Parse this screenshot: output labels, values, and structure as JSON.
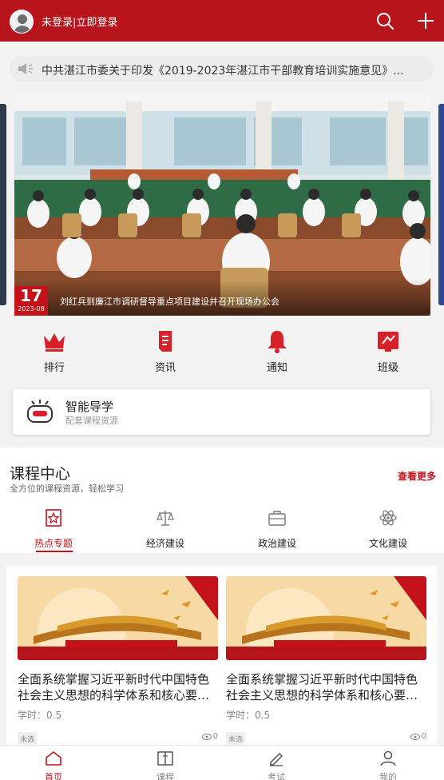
{
  "header": {
    "login_text": "未登录|立即登录",
    "icons": [
      "search-icon",
      "plus-icon"
    ],
    "brand_color": "#b8141c"
  },
  "notice": {
    "text": "中共湛江市委关于印发《2019-2023年湛江市干部教育培训实施意见》..."
  },
  "banner": {
    "day": "17",
    "month": "2023-08",
    "caption": "刘红兵到廉江市调研督导重点项目建设并召开现场办公会"
  },
  "quick_links": [
    {
      "label": "排行",
      "icon": "crown-icon"
    },
    {
      "label": "资讯",
      "icon": "document-icon"
    },
    {
      "label": "通知",
      "icon": "bell-icon"
    },
    {
      "label": "班级",
      "icon": "class-icon"
    }
  ],
  "ai_guide": {
    "title": "智能导学",
    "subtitle": "配套课程资源"
  },
  "course_center": {
    "title": "课程中心",
    "subtitle": "全方位的课程资源，轻松学习",
    "more": "查看更多",
    "tabs": [
      {
        "label": "热点专题",
        "icon": "star-badge-icon",
        "active": true
      },
      {
        "label": "经济建设",
        "icon": "scale-icon",
        "active": false
      },
      {
        "label": "政治建设",
        "icon": "briefcase-icon",
        "active": false
      },
      {
        "label": "文化建设",
        "icon": "atom-icon",
        "active": false
      }
    ],
    "cards": [
      {
        "title": "全面系统掌握习近平新时代中国特色社会主义思想的科学体系和核心要义...",
        "hours": "学时：0.5",
        "tag": "未选",
        "views": "0"
      },
      {
        "title": "全面系统掌握习近平新时代中国特色社会主义思想的科学体系和核心要义...",
        "hours": "学时：0.5",
        "tag": "未选",
        "views": "0"
      }
    ]
  },
  "tabbar": [
    {
      "label": "首页",
      "icon": "home-icon",
      "active": true
    },
    {
      "label": "课程",
      "icon": "book-icon",
      "active": false
    },
    {
      "label": "考试",
      "icon": "pen-icon",
      "active": false
    },
    {
      "label": "我的",
      "icon": "user-icon",
      "active": false
    }
  ]
}
